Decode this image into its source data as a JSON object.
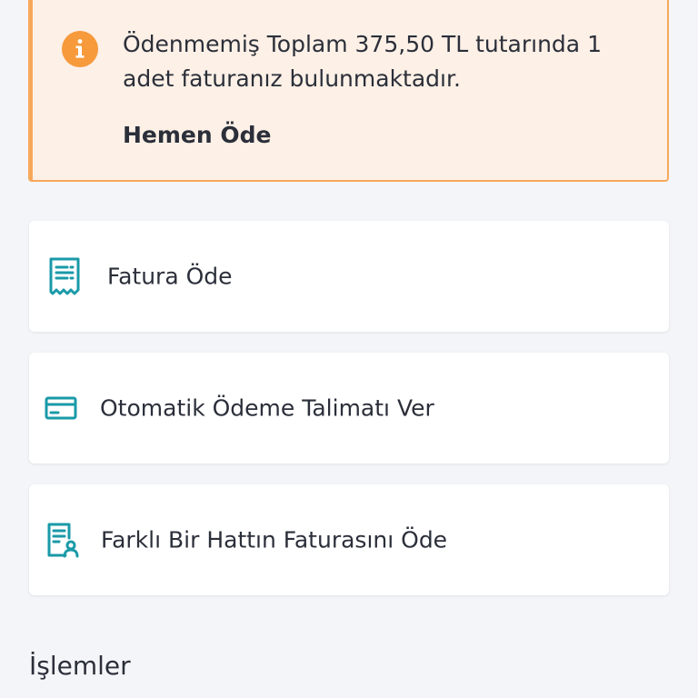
{
  "alert": {
    "icon": "info-icon",
    "message": "Ödenmemiş Toplam 375,50 TL tutarında 1 adet faturanız bulunmaktadır.",
    "action_label": "Hemen Öde",
    "accent_color": "#f6a85a",
    "background_color": "#fdf0e6"
  },
  "actions": [
    {
      "icon": "receipt-icon",
      "label": "Fatura Öde"
    },
    {
      "icon": "credit-card-icon",
      "label": "Otomatik Ödeme Talimatı Ver"
    },
    {
      "icon": "document-user-icon",
      "label": "Farklı Bir Hattın Faturasını Öde"
    }
  ],
  "icon_color": "#1a9aa8",
  "section": {
    "title": "İşlemler"
  }
}
